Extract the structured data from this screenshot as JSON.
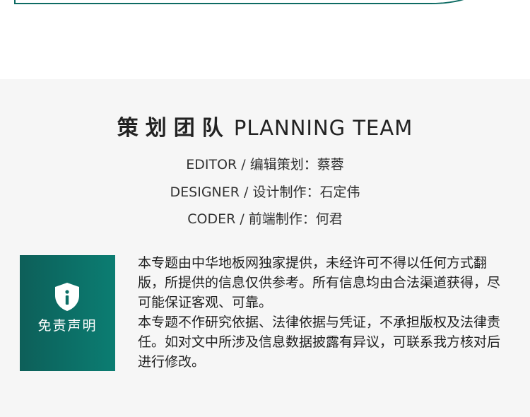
{
  "planning_team": {
    "title_cn": "策划团队",
    "title_en": "PLANNING TEAM",
    "credits": [
      "EDITOR / 编辑策划：蔡蓉",
      "DESIGNER / 设计制作：石定伟",
      "CODER / 前端制作：何君"
    ]
  },
  "disclaimer": {
    "label": "免责声明",
    "icon": "shield-info-icon",
    "paragraphs": [
      "本专题由中华地板网独家提供，未经许可不得以任何方式翻版，所提供的信息仅供参考。所有信息均由合法渠道获得，尽可能保证客观、可靠。",
      "本专题不作研究依据、法律依据与凭证，不承担版权及法律责任。如对文中所涉及信息数据披露有异议，可联系我方核对后进行修改。"
    ]
  },
  "colors": {
    "accent": "#0d6b63",
    "panel_bg": "#f6f6f6",
    "text": "#222222"
  }
}
